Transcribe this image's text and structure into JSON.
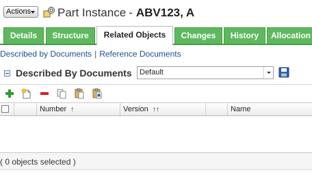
{
  "header": {
    "actions_label": "Actions",
    "title_type": "Part Instance",
    "title_separator": "-",
    "title_id": "ABV123, A"
  },
  "tabs": [
    {
      "label": "Details",
      "active": false
    },
    {
      "label": "Structure",
      "active": false
    },
    {
      "label": "Related Objects",
      "active": true
    },
    {
      "label": "Changes",
      "active": false
    },
    {
      "label": "History",
      "active": false
    },
    {
      "label": "Allocation",
      "active": false
    }
  ],
  "subnav": {
    "described_by": "Described by Documents",
    "separator": "|",
    "reference": "Reference Documents"
  },
  "section": {
    "title": "Described By Documents",
    "view_value": "Default"
  },
  "toolbar": {
    "icons": [
      "add-icon",
      "new-document-icon",
      "remove-icon",
      "copy-icon",
      "paste-icon",
      "paste-special-icon"
    ]
  },
  "table": {
    "columns": [
      {
        "label": "",
        "sort": ""
      },
      {
        "label": "",
        "sort": ""
      },
      {
        "label": "Number",
        "sort": "↑"
      },
      {
        "label": "Version",
        "sort": "↑↑"
      },
      {
        "label": "",
        "sort": ""
      },
      {
        "label": "Name",
        "sort": ""
      }
    ],
    "rows": []
  },
  "footer": {
    "selection_text": "( 0 objects selected )"
  },
  "colors": {
    "tab_green": "#5fb85f",
    "link_blue": "#1f4f8f",
    "add_green": "#2e9b2e",
    "remove_red": "#d42020"
  }
}
